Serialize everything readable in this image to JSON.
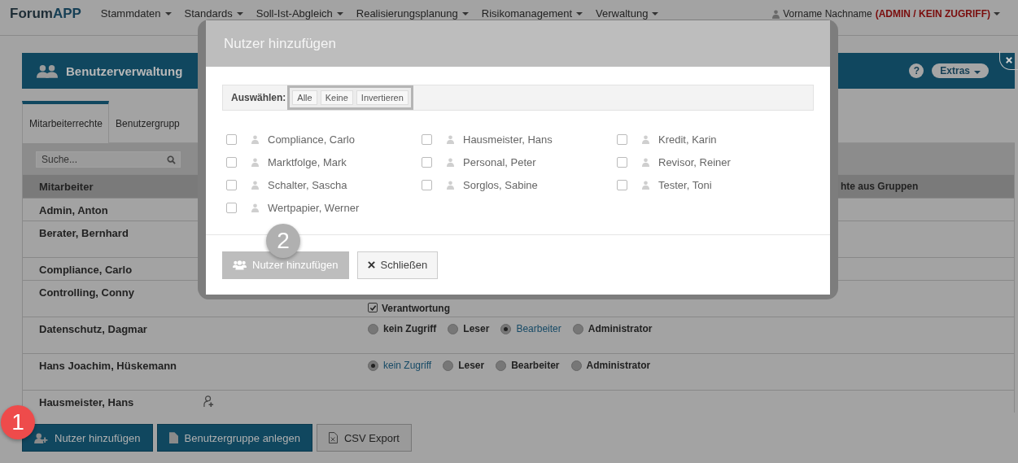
{
  "navbar": {
    "logo": {
      "part_1": "Forum",
      "part_2": "APP"
    },
    "menu": [
      {
        "label": "Stammdaten"
      },
      {
        "label": "Standards"
      },
      {
        "label": "Soll-Ist-Abgleich"
      },
      {
        "label": "Realisierungsplanung"
      },
      {
        "label": "Risikomanagement"
      },
      {
        "label": "Verwaltung"
      }
    ],
    "user": {
      "name": "Vorname Nachname",
      "role": "(ADMIN / KEIN ZUGRIFF)"
    }
  },
  "panel": {
    "title": "Benutzerverwaltung",
    "help": "?",
    "extras": "Extras"
  },
  "tabs": [
    {
      "label": "Mitarbeiterrechte",
      "selected": true
    },
    {
      "label": "Benutzergrupp",
      "selected": false
    }
  ],
  "search": {
    "placeholder": "Suche..."
  },
  "table": {
    "columns": [
      "Mitarbeiter",
      "hte aus Gruppen"
    ],
    "rows": [
      {
        "name": "Admin, Anton",
        "tall": false
      },
      {
        "name": "Berater, Bernhard",
        "tall": true
      },
      {
        "name": "Compliance, Carlo",
        "tall": false
      },
      {
        "name": "Controlling, Conny",
        "tall": true,
        "rights": {
          "kind": "checkbox",
          "label": "Verantwortung",
          "checked": true
        }
      },
      {
        "name": "Datenschutz, Dagmar",
        "tall": true,
        "rights": {
          "kind": "radio",
          "options": [
            {
              "label": "kein Zugriff",
              "selected": false
            },
            {
              "label": "Leser",
              "selected": false
            },
            {
              "label": "Bearbeiter",
              "selected": true
            },
            {
              "label": "Administrator",
              "selected": false
            }
          ]
        }
      },
      {
        "name": "Hans Joachim, Hüskemann",
        "tall": true,
        "rights": {
          "kind": "radio",
          "options": [
            {
              "label": "kein Zugriff",
              "selected": true
            },
            {
              "label": "Leser",
              "selected": false
            },
            {
              "label": "Bearbeiter",
              "selected": false
            },
            {
              "label": "Administrator",
              "selected": false
            }
          ]
        }
      },
      {
        "name": "Hausmeister, Hans",
        "tall": false,
        "rights": {
          "kind": "icon"
        }
      }
    ]
  },
  "actions": [
    {
      "label": "Nutzer hinzufügen",
      "kind": "add-user"
    },
    {
      "label": "Benutzergruppe anlegen",
      "kind": "group"
    },
    {
      "label": "CSV Export",
      "kind": "csv"
    }
  ],
  "callouts": [
    {
      "label": "1",
      "kind": "red"
    },
    {
      "label": "2",
      "kind": "grey"
    }
  ],
  "modal": {
    "title": "Nutzer hinzufügen",
    "select_label": "Auswählen:",
    "select_buttons": [
      "Alle",
      "Keine",
      "Invertieren"
    ],
    "users": [
      {
        "name": "Compliance, Carlo",
        "checked": false
      },
      {
        "name": "Hausmeister, Hans",
        "checked": false
      },
      {
        "name": "Kredit, Karin",
        "checked": false
      },
      {
        "name": "Marktfolge, Mark",
        "checked": false
      },
      {
        "name": "Personal, Peter",
        "checked": false
      },
      {
        "name": "Revisor, Reiner",
        "checked": false
      },
      {
        "name": "Schalter, Sascha",
        "checked": false
      },
      {
        "name": "Sorglos, Sabine",
        "checked": false
      },
      {
        "name": "Tester, Toni",
        "checked": false
      },
      {
        "name": "Wertpapier, Werner",
        "checked": false
      }
    ],
    "add_button": {
      "label": "Nutzer hinzufügen",
      "disabled": true
    },
    "close_button": {
      "label": "Schließen"
    }
  }
}
